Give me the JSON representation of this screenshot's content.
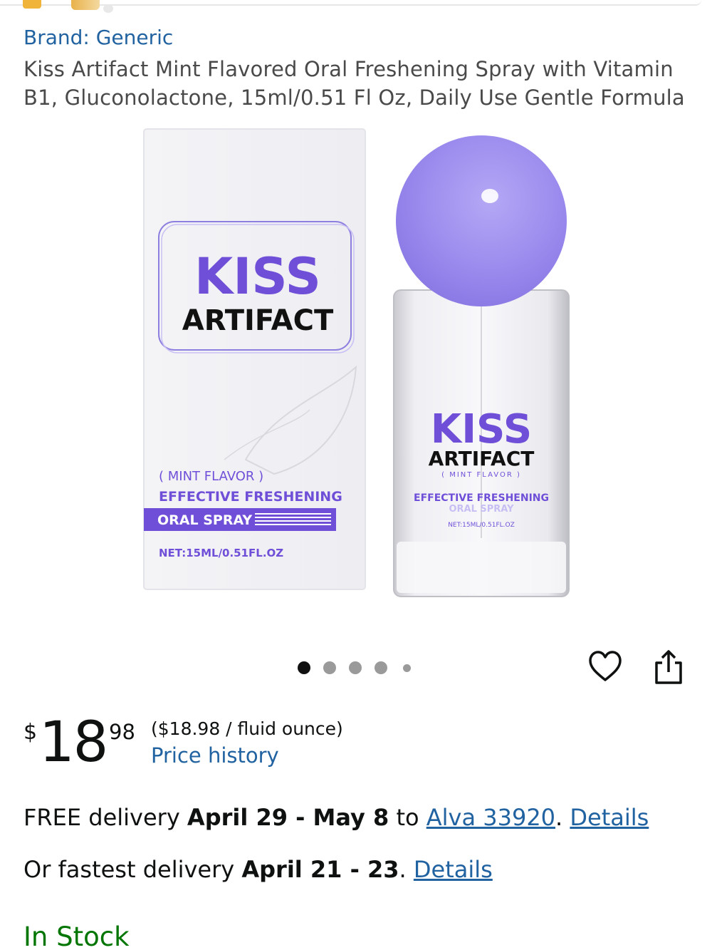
{
  "brand": {
    "label": "Brand: Generic"
  },
  "product": {
    "title": "Kiss Artifact Mint Flavored Oral Freshening Spray with Vitamin B1, Gluconolactone, 15ml/0.51 Fl Oz, Daily Use Gentle Formula",
    "image": {
      "box_brand_1": "KISS",
      "box_brand_2": "ARTIFACT",
      "box_flavor": "( MINT FLAVOR )",
      "box_line1": "EFFECTIVE FRESHENING",
      "box_line2": "ORAL SPRAY",
      "box_net": "NET:15ML/0.51FL.OZ",
      "bottle_brand_1": "KISS",
      "bottle_brand_2": "ARTIFACT",
      "bottle_flavor": "( MINT FLAVOR )",
      "bottle_line1": "EFFECTIVE FRESHENING",
      "bottle_line2": "ORAL SPRAY",
      "bottle_net": "NET:15ML/0.51FL.OZ"
    }
  },
  "carousel": {
    "count": 5,
    "active_index": 0
  },
  "actions": {
    "favorite_icon": "heart-icon",
    "share_icon": "share-icon"
  },
  "price": {
    "symbol": "$",
    "whole": "18",
    "fraction": "98",
    "unit_price": "($18.98 / fluid ounce)",
    "history_link": "Price history"
  },
  "delivery": {
    "free_prefix": "FREE delivery ",
    "free_dates": "April 29 - May 8",
    "to_text": " to ",
    "location": "Alva 33920",
    "period": ".",
    "details": "Details",
    "fastest_prefix": "Or fastest delivery ",
    "fastest_dates": "April 21 - 23",
    "fastest_period": ".",
    "fastest_details": "Details"
  },
  "stock": {
    "status": "In Stock"
  },
  "colors": {
    "link": "#2162a1",
    "in_stock": "#007600",
    "brand_purple": "#6f4fd8",
    "cap_purple": "#9e8ff0"
  }
}
